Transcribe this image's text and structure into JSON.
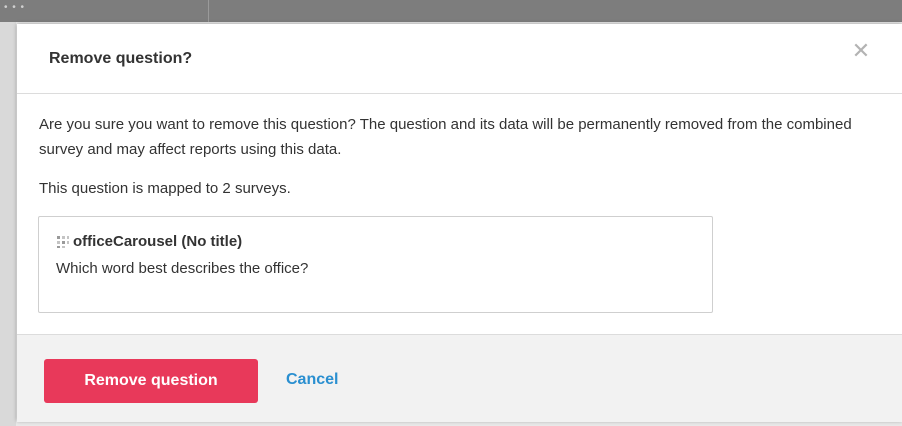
{
  "backdrop": {
    "top_dots": "• • •"
  },
  "dialog": {
    "title": "Remove question?",
    "close_icon": "close-icon",
    "close_glyph": "✕",
    "message": "Are you sure you want to remove this question? The question and its data will be permanently removed from the combined survey and may affect reports using this data.",
    "mapped_note": "This question is mapped to 2 surveys.",
    "question": {
      "icon": "carousel-icon",
      "name": "officeCarousel (No title)",
      "text": "Which word best describes the office?"
    },
    "footer": {
      "remove_label": "Remove question",
      "cancel_label": "Cancel"
    }
  },
  "colors": {
    "primary_button": "#e8395a",
    "link": "#2a8fd0",
    "text": "#333333"
  }
}
